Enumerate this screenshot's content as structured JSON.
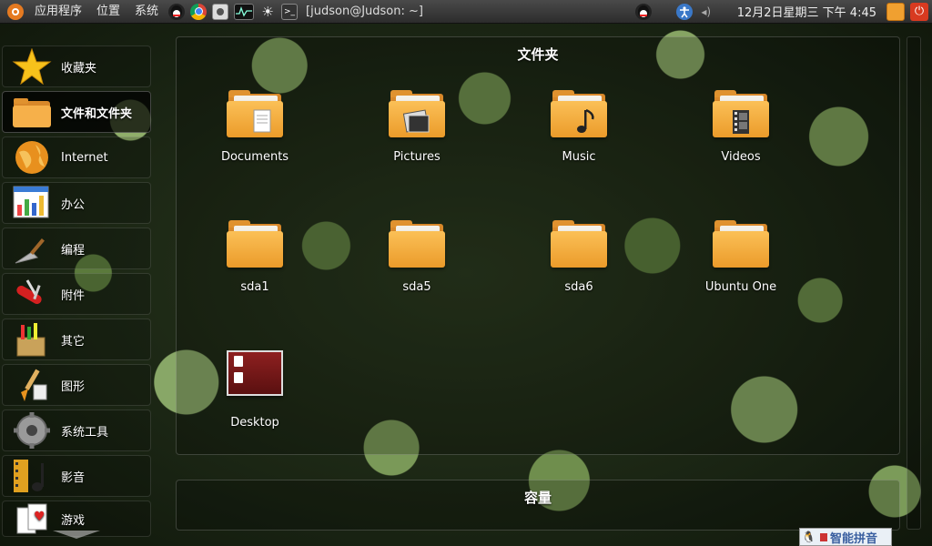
{
  "top_panel": {
    "menu": [
      "应用程序",
      "位置",
      "系统"
    ],
    "terminal_title": "[judson@Judson: ~]",
    "clock": "12月2日星期三 下午 4:45"
  },
  "sidebar": {
    "items": [
      {
        "label": "收藏夹",
        "icon": "star-icon"
      },
      {
        "label": "文件和文件夹",
        "icon": "folder-icon",
        "active": true
      },
      {
        "label": "Internet",
        "icon": "globe-icon"
      },
      {
        "label": "办公",
        "icon": "spreadsheet-icon"
      },
      {
        "label": "编程",
        "icon": "trowel-icon"
      },
      {
        "label": "附件",
        "icon": "swiss-knife-icon"
      },
      {
        "label": "其它",
        "icon": "box-icon"
      },
      {
        "label": "图形",
        "icon": "paintbrush-icon"
      },
      {
        "label": "系统工具",
        "icon": "gear-icon"
      },
      {
        "label": "影音",
        "icon": "film-music-icon"
      },
      {
        "label": "游戏",
        "icon": "cards-icon"
      }
    ]
  },
  "main": {
    "folders_title": "文件夹",
    "capacity_title": "容量",
    "folders": [
      {
        "label": "Documents",
        "icon": "documents-folder-icon"
      },
      {
        "label": "Pictures",
        "icon": "pictures-folder-icon"
      },
      {
        "label": "Music",
        "icon": "music-folder-icon"
      },
      {
        "label": "Videos",
        "icon": "videos-folder-icon"
      },
      {
        "label": "sda1",
        "icon": "folder-icon"
      },
      {
        "label": "sda5",
        "icon": "folder-icon"
      },
      {
        "label": "sda6",
        "icon": "folder-icon"
      },
      {
        "label": "Ubuntu One",
        "icon": "folder-icon"
      },
      {
        "label": "Desktop",
        "icon": "desktop-icon"
      }
    ]
  },
  "ime": {
    "label": "智能拼音"
  },
  "colors": {
    "accent": "#e57a21",
    "folder": "#f0a83a",
    "panel": "#2c2c2c"
  }
}
